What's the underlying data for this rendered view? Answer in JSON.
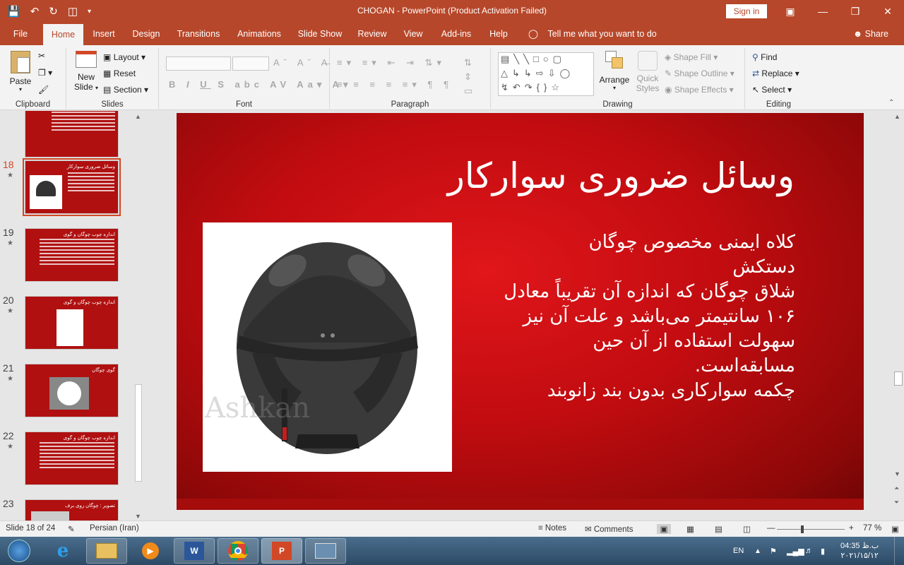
{
  "titlebar": {
    "title": "CHOGAN  -  PowerPoint (Product Activation Failed)",
    "signin": "Sign in"
  },
  "tabs": [
    "File",
    "Home",
    "Insert",
    "Design",
    "Transitions",
    "Animations",
    "Slide Show",
    "Review",
    "View",
    "Add-ins",
    "Help"
  ],
  "active_tab": "Home",
  "tellme": "Tell me what you want to do",
  "share": "Share",
  "ribbon": {
    "clipboard": {
      "label": "Clipboard",
      "paste": "Paste"
    },
    "slides": {
      "label": "Slides",
      "new_slide_1": "New",
      "new_slide_2": "Slide",
      "layout": "Layout",
      "reset": "Reset",
      "section": "Section"
    },
    "font": {
      "label": "Font"
    },
    "paragraph": {
      "label": "Paragraph"
    },
    "drawing": {
      "label": "Drawing",
      "arrange": "Arrange",
      "quick_styles_1": "Quick",
      "quick_styles_2": "Styles",
      "shape_fill": "Shape Fill",
      "shape_outline": "Shape Outline",
      "shape_effects": "Shape Effects"
    },
    "editing": {
      "label": "Editing",
      "find": "Find",
      "replace": "Replace",
      "select": "Select"
    }
  },
  "thumbnails": [
    {
      "num": "18",
      "title": "وسائل ضروری سوارکار",
      "selected": true
    },
    {
      "num": "19",
      "title": "اندازه چوب چوگان و گوی"
    },
    {
      "num": "20",
      "title": "اندازه چوب چوگان و گوی"
    },
    {
      "num": "21",
      "title": "گوی چوگان"
    },
    {
      "num": "22",
      "title": "اندازه چوب چوگان و گوی"
    },
    {
      "num": "23",
      "title": "تصویر : چوگان روی برف"
    }
  ],
  "slide": {
    "title": "وسائل ضروری سوارکار",
    "body": [
      "کلاه ایمنی مخصوص چوگان",
      "دستکش",
      "شلاق چوگان که اندازه آن تقریباً معادل ۱۰۶ سانتیمتر می‌باشد و علت آن نیز سهولت استفاده از آن حین مسابقه‌است.",
      "چکمه سوارکاری بدون بند زانوبند"
    ],
    "watermark": "Ashkan"
  },
  "statusbar": {
    "slide_info": "Slide 18 of 24",
    "language": "Persian (Iran)",
    "notes": "Notes",
    "comments": "Comments",
    "zoom": "77 %"
  },
  "taskbar": {
    "lang": "EN",
    "time": "04:35 ب.ظ",
    "date": "۲۰۲۱/۱۵/۱۲"
  },
  "colors": {
    "accent": "#b7472a",
    "slide_red": "#c10c10"
  }
}
